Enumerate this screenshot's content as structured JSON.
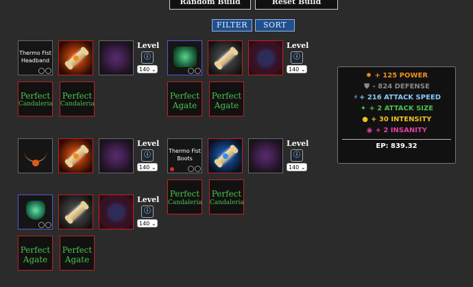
{
  "top_buttons": {
    "random": "Random Build",
    "reset": "Reset Build"
  },
  "controls": {
    "filter": "FILTER",
    "sort": "SORT"
  },
  "level_label": "Level",
  "level_value": "140",
  "items": {
    "headband": {
      "line1": "Thermo Fist",
      "line2": "Headband"
    },
    "boots": {
      "line1": "Thermo Fist",
      "line2": "Boots"
    }
  },
  "gems": {
    "quality": "Perfect",
    "candaleria": "Candaleria",
    "agate": "Agate"
  },
  "stats": {
    "power": "+ 125 POWER",
    "defense": "- 824 DEFENSE",
    "attack_speed": "+ 216 ATTACK SPEED",
    "attack_size": "+ 2 ATTACK SIZE",
    "intensity": "+ 30 INTENSITY",
    "insanity": "+ 2 INSANITY",
    "ep": "EP: 839.32"
  },
  "colors": {
    "power": "#f0901e",
    "defense": "#8a8a8a",
    "attack_speed": "#8ac8ff",
    "attack_size": "#4cc04c",
    "intensity": "#f0c020",
    "insanity": "#e040a0",
    "gem_text": "#4dc24d"
  }
}
